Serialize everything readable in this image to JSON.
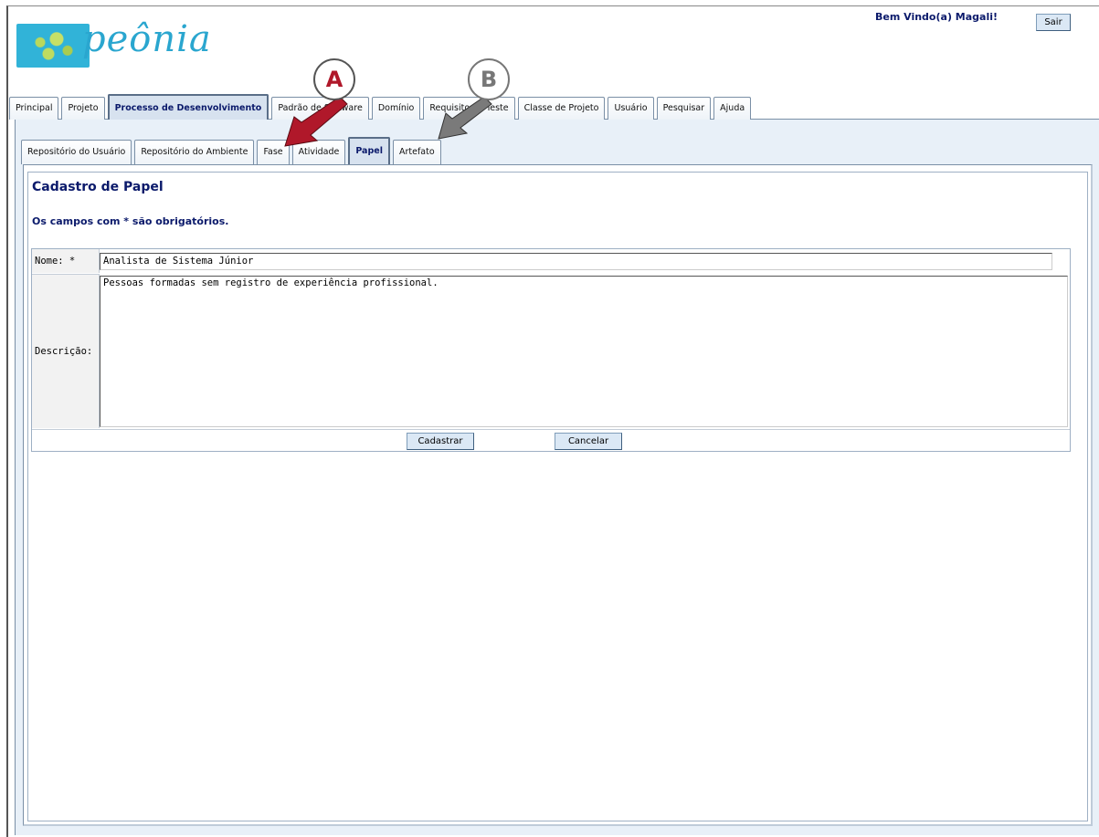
{
  "header": {
    "logo_text": "peônia",
    "welcome": "Bem Vindo(a) Magali!",
    "logout_label": "Sair"
  },
  "main_tabs": [
    {
      "label": "Principal",
      "active": false
    },
    {
      "label": "Projeto",
      "active": false
    },
    {
      "label": "Processo de Desenvolvimento",
      "active": true
    },
    {
      "label": "Padrão de Software",
      "active": false
    },
    {
      "label": "Domínio",
      "active": false
    },
    {
      "label": "Requisito de Teste",
      "active": false
    },
    {
      "label": "Classe de Projeto",
      "active": false
    },
    {
      "label": "Usuário",
      "active": false
    },
    {
      "label": "Pesquisar",
      "active": false
    },
    {
      "label": "Ajuda",
      "active": false
    }
  ],
  "sub_tabs": [
    {
      "label": "Repositório do Usuário",
      "active": false
    },
    {
      "label": "Repositório do Ambiente",
      "active": false
    },
    {
      "label": "Fase",
      "active": false
    },
    {
      "label": "Atividade",
      "active": false
    },
    {
      "label": "Papel",
      "active": true
    },
    {
      "label": "Artefato",
      "active": false
    }
  ],
  "form": {
    "title": "Cadastro de Papel",
    "required_note": "Os campos com * são obrigatórios.",
    "nome_label": "Nome: *",
    "nome_value": "Analista de Sistema Júnior",
    "descricao_label": "Descrição:",
    "descricao_value": "Pessoas formadas sem registro de experiência profissional.",
    "submit_label": "Cadastrar",
    "cancel_label": "Cancelar"
  },
  "annotations": {
    "marker_a": "A",
    "marker_b": "B",
    "marker_a_color": "#b0182a",
    "marker_b_color": "#777777"
  },
  "colors": {
    "accent": "#0b1a6b",
    "logo": "#2aa6cf",
    "panel": "#e8f0f8"
  }
}
